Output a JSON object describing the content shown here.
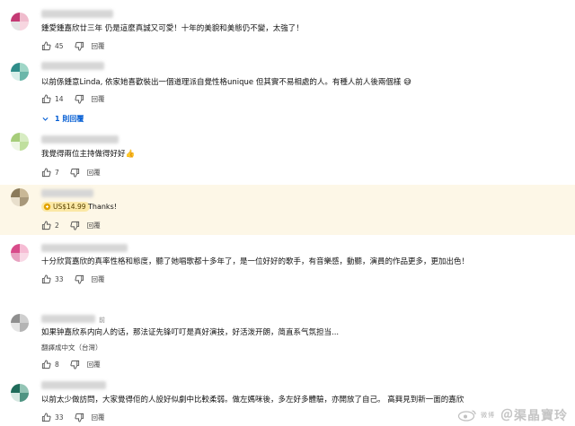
{
  "comments": [
    {
      "id": "c1",
      "avatar_colors": [
        "#c43a74",
        "#f0bccd",
        "#e4e4e4",
        "#f7d6e0"
      ],
      "text": "鍾愛鍾嘉欣廿三年 仍是這麼真誠又可愛！十年的美貌和美態仍不變，太強了！",
      "likes": "45",
      "reply_label": "回覆"
    },
    {
      "id": "c2",
      "avatar_colors": [
        "#2f8d8a",
        "#9fd6c7",
        "#d8efe9",
        "#6bb7aa"
      ],
      "text": "以前係鍾意Linda, 依家她喜歡裝出一個道理派自覺性格unique 但其實不易相處的人。有種人前人後兩個樣",
      "emoji": "😅",
      "likes": "14",
      "reply_label": "回覆",
      "replies_link": "1 則回覆"
    },
    {
      "id": "c3",
      "avatar_colors": [
        "#a6cd7a",
        "#d7ecc2",
        "#eef6e5",
        "#c0df9e"
      ],
      "text": "我覺得兩位主持做得好好",
      "emoji": "👍",
      "likes": "7",
      "reply_label": "回覆"
    },
    {
      "id": "c4",
      "avatar_colors": [
        "#8a7a5a",
        "#c9b896",
        "#e8dfcc",
        "#a8987a"
      ],
      "super_chat": "US$14.99",
      "text": "Thanks!",
      "likes": "2",
      "reply_label": "回覆"
    },
    {
      "id": "c5",
      "avatar_colors": [
        "#d84b8a",
        "#f6bcd4",
        "#e7a1c0",
        "#f9d9e6"
      ],
      "text": "十分欣賞嘉欣的真率性格和態度，聽了她唱歌都十多年了，是一位好好的歌手，有音樂感，動聽，演員的作品更多，更加出色！",
      "likes": "33",
      "reply_label": "回覆"
    },
    {
      "id": "c6",
      "avatar_colors": [
        "#8f8f8f",
        "#cfcfcf",
        "#e5e5e5",
        "#b4b4b4"
      ],
      "age": "前",
      "text": "如果钟嘉欣系内向人的话，那法证先锋叮叮是真好演技，好活泼开朗，简直系气氛担当...",
      "translate": "翻譯成中文（台灣）",
      "likes": "8",
      "reply_label": "回覆"
    },
    {
      "id": "c7",
      "avatar_colors": [
        "#1f6b5a",
        "#93c4b5",
        "#d6e8e2",
        "#4f9482"
      ],
      "text": "以前太少做訪問，大家覺得佢的人設好似劇中比較柔弱。做左媽咪後，多左好多體驗，亦開放了自己。 高興見到新一面的嘉欣",
      "likes": "33",
      "reply_label": "回覆"
    }
  ],
  "watermark": {
    "prefix": "微博",
    "text": "＠渠晶寶玲"
  }
}
